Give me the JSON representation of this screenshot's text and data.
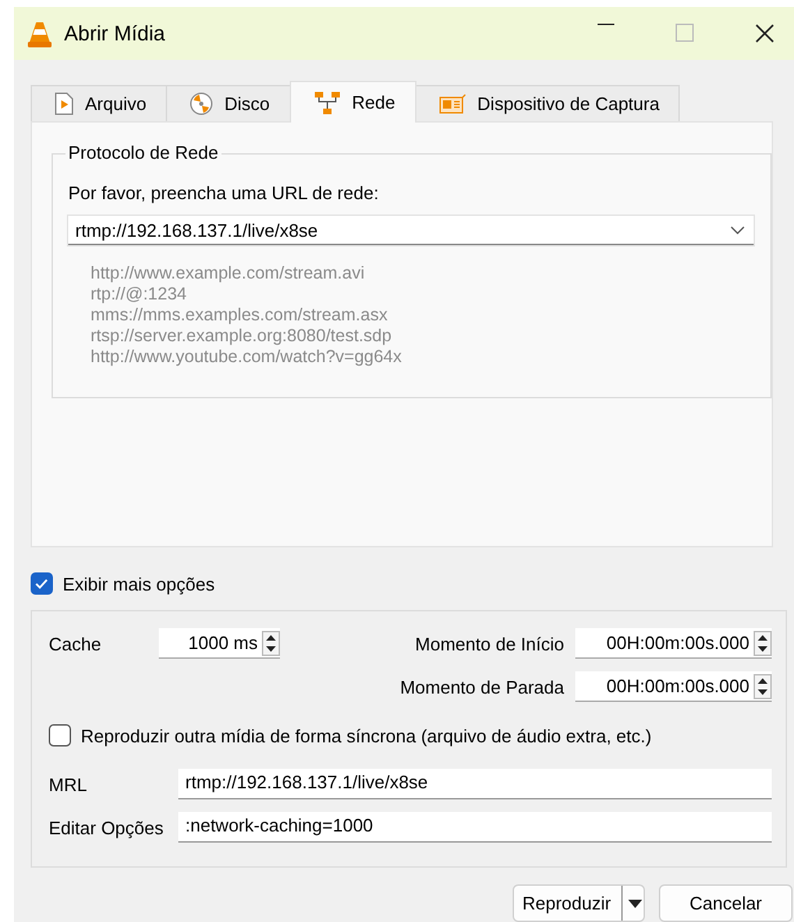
{
  "window": {
    "title": "Abrir Mídia"
  },
  "tabs": [
    {
      "label": "Arquivo",
      "kind": "file",
      "selected": false
    },
    {
      "label": "Disco",
      "kind": "disc",
      "selected": false
    },
    {
      "label": "Rede",
      "kind": "network",
      "selected": true
    },
    {
      "label": "Dispositivo de Captura",
      "kind": "capture",
      "selected": false
    }
  ],
  "network": {
    "group_title": "Protocolo de Rede",
    "prompt": "Por favor, preencha uma URL de rede:",
    "url": "rtmp://192.168.137.1/live/x8se",
    "examples": [
      "http://www.example.com/stream.avi",
      "rtp://@:1234",
      "mms://mms.examples.com/stream.asx",
      "rtsp://server.example.org:8080/test.sdp",
      "http://www.youtube.com/watch?v=gg64x"
    ]
  },
  "show_more": {
    "label": "Exibir mais opções",
    "checked": true
  },
  "options": {
    "cache": {
      "label": "Cache",
      "value": "1000 ms"
    },
    "start": {
      "label": "Momento de Início",
      "value": "00H:00m:00s.000"
    },
    "stop": {
      "label": "Momento de Parada",
      "value": "00H:00m:00s.000"
    },
    "sync": {
      "label": "Reproduzir outra mídia de forma síncrona (arquivo de áudio extra, etc.)",
      "checked": false
    },
    "mrl": {
      "label": "MRL",
      "value": "rtmp://192.168.137.1/live/x8se"
    },
    "edit_options": {
      "label": "Editar Opções",
      "value": ":network-caching=1000"
    }
  },
  "buttons": [
    {
      "label": "Reproduzir",
      "kind": "split"
    },
    {
      "label": "Cancelar",
      "kind": "plain"
    }
  ]
}
